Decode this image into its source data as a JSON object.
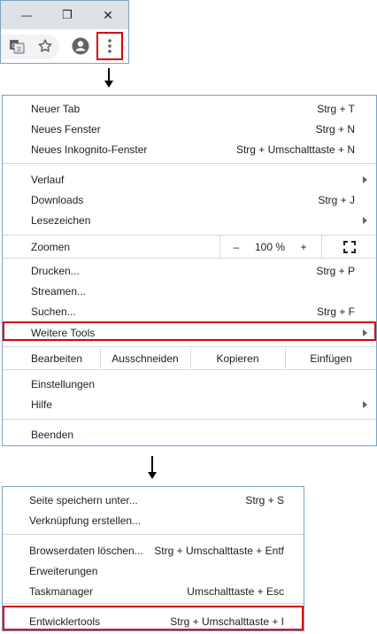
{
  "window_controls": {
    "minimize": "—",
    "restore": "❐",
    "close": "✕"
  },
  "toolbar": {
    "translate_icon": "translate-icon",
    "bookmark_icon": "star-icon",
    "profile_icon": "account-circle-icon",
    "menu_icon": "more-vert-icon",
    "highlight_color": "#d9000d"
  },
  "main_menu": {
    "items": [
      {
        "label": "Neuer Tab",
        "shortcut": "Strg + T"
      },
      {
        "label": "Neues Fenster",
        "shortcut": "Strg + N"
      },
      {
        "label": "Neues Inkognito-Fenster",
        "shortcut": "Strg + Umschalttaste + N"
      },
      {
        "label": "Verlauf",
        "submenu": true
      },
      {
        "label": "Downloads",
        "shortcut": "Strg + J"
      },
      {
        "label": "Lesezeichen",
        "submenu": true
      },
      {
        "label": "Drucken...",
        "shortcut": "Strg + P"
      },
      {
        "label": "Streamen..."
      },
      {
        "label": "Suchen...",
        "shortcut": "Strg + F"
      },
      {
        "label": "Weitere Tools",
        "submenu": true,
        "highlighted": true
      },
      {
        "label": "Einstellungen"
      },
      {
        "label": "Hilfe",
        "submenu": true
      },
      {
        "label": "Beenden"
      }
    ],
    "zoom": {
      "label": "Zoomen",
      "minus": "–",
      "value": "100 %",
      "plus": "+",
      "fullscreen_icon": "fullscreen-icon"
    },
    "edit": {
      "label": "Bearbeiten",
      "cut": "Ausschneiden",
      "copy": "Kopieren",
      "paste": "Einfügen"
    }
  },
  "more_tools_menu": {
    "items": [
      {
        "label": "Seite speichern unter...",
        "shortcut": "Strg + S"
      },
      {
        "label": "Verknüpfung erstellen..."
      },
      {
        "label": "Browserdaten löschen...",
        "shortcut": "Strg + Umschalttaste + Entf"
      },
      {
        "label": "Erweiterungen"
      },
      {
        "label": "Taskmanager",
        "shortcut": "Umschalttaste + Esc"
      },
      {
        "label": "Entwicklertools",
        "shortcut": "Strg + Umschalttaste + I",
        "highlighted": true
      }
    ]
  }
}
